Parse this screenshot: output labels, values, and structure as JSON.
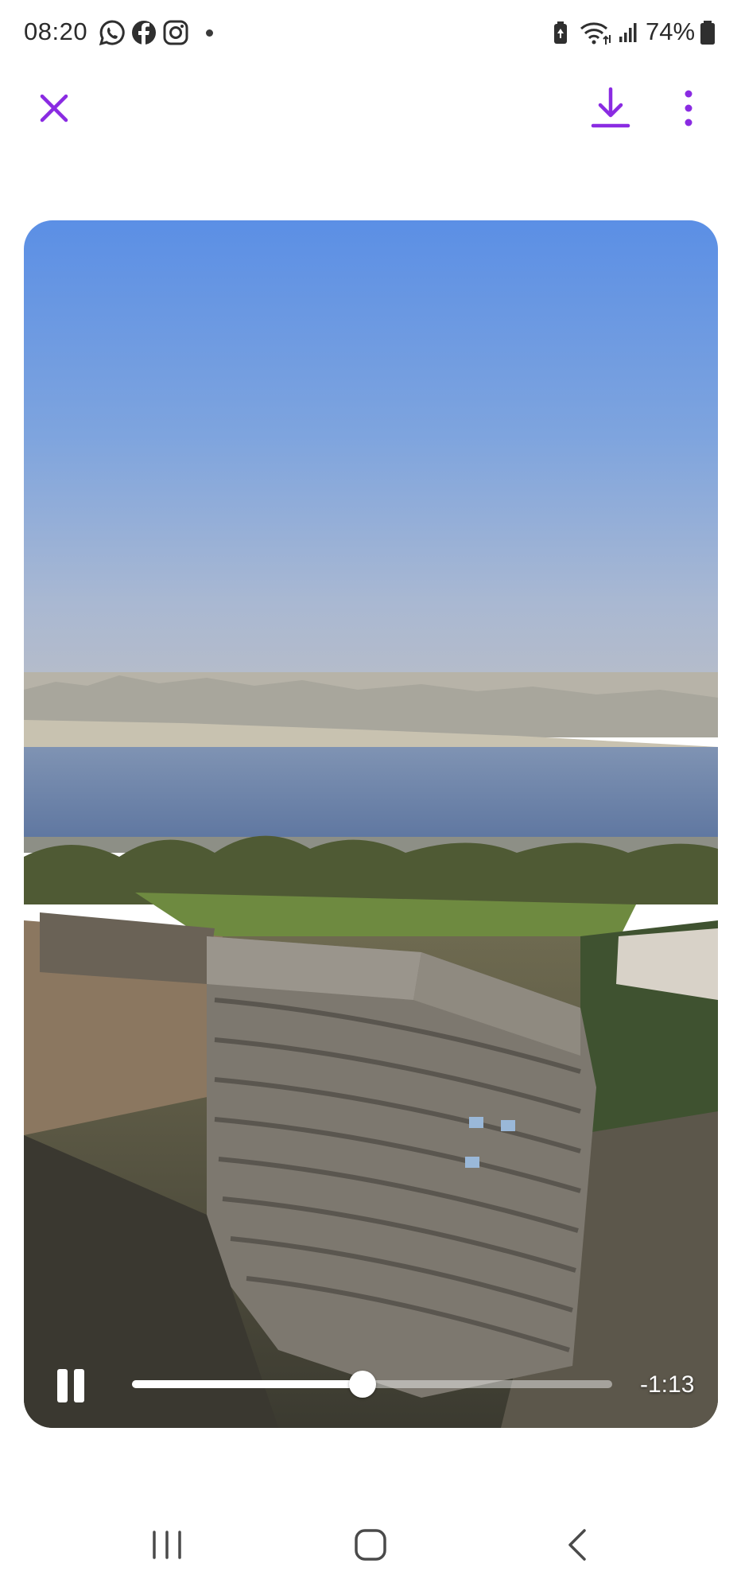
{
  "status_bar": {
    "time": "08:20",
    "notification_icons": [
      "whatsapp-icon",
      "facebook-icon",
      "instagram-icon",
      "dot-icon"
    ],
    "system_icons": [
      "battery-saver-icon",
      "wifi-icon",
      "signal-icon",
      "battery-icon"
    ],
    "battery": "74%"
  },
  "app_bar": {
    "accent_color": "#8a2be2",
    "close_icon": "close-icon",
    "download_icon": "download-icon",
    "more_icon": "more-vertical-icon"
  },
  "video_player": {
    "state": "playing",
    "pause_icon": "pause-icon",
    "progress": 0.48,
    "time_remaining": "-1:13"
  },
  "nav_bar": {
    "buttons": [
      "recent-apps-icon",
      "home-icon",
      "back-icon"
    ]
  }
}
